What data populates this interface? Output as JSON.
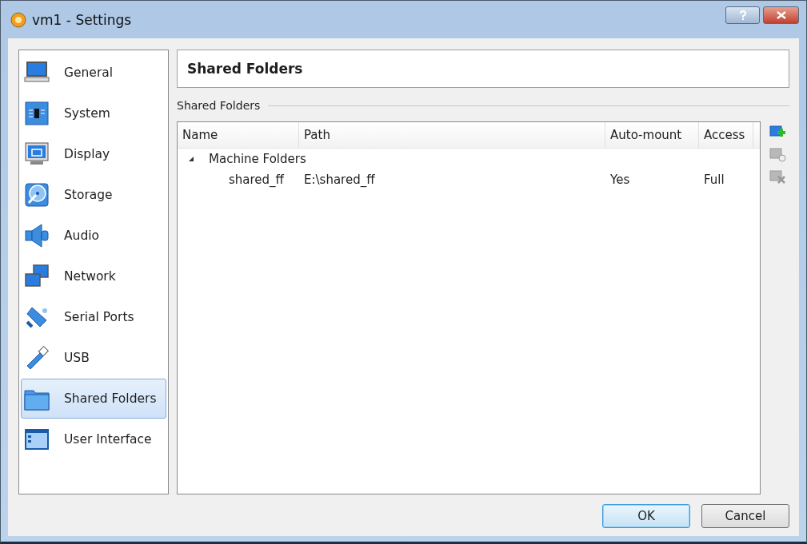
{
  "window": {
    "title": "vm1 - Settings"
  },
  "sidebar": {
    "items": [
      {
        "label": "General",
        "kind": "laptop",
        "selected": false
      },
      {
        "label": "System",
        "kind": "chip",
        "selected": false
      },
      {
        "label": "Display",
        "kind": "monitor",
        "selected": false
      },
      {
        "label": "Storage",
        "kind": "disc",
        "selected": false
      },
      {
        "label": "Audio",
        "kind": "speaker",
        "selected": false
      },
      {
        "label": "Network",
        "kind": "network",
        "selected": false
      },
      {
        "label": "Serial Ports",
        "kind": "serial",
        "selected": false
      },
      {
        "label": "USB",
        "kind": "usb",
        "selected": false
      },
      {
        "label": "Shared Folders",
        "kind": "folder",
        "selected": true
      },
      {
        "label": "User Interface",
        "kind": "window",
        "selected": false
      }
    ]
  },
  "page_title": "Shared Folders",
  "group_label": "Shared Folders",
  "table": {
    "columns": [
      "Name",
      "Path",
      "Auto-mount",
      "Access"
    ],
    "rows": [
      {
        "name": "Machine Folders",
        "expanded": true,
        "children": [
          {
            "name": "shared_ff",
            "path": "E:\\shared_ff",
            "auto_mount": "Yes",
            "access": "Full"
          }
        ]
      }
    ]
  },
  "toolbar": [
    {
      "kind": "add",
      "disabled": false
    },
    {
      "kind": "edit",
      "disabled": true
    },
    {
      "kind": "remove",
      "disabled": true
    }
  ],
  "buttons": [
    {
      "label": "OK",
      "default": true
    },
    {
      "label": "Cancel",
      "default": false
    }
  ]
}
